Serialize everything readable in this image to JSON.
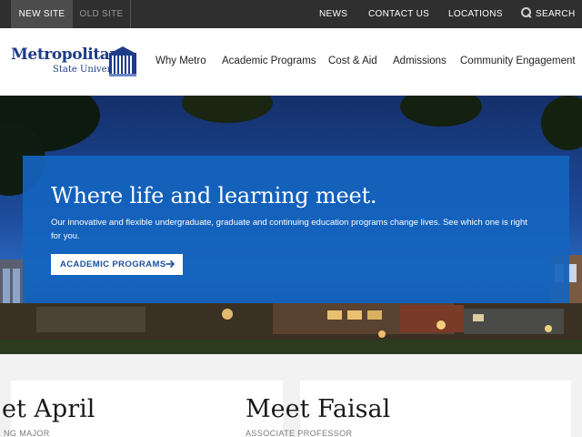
{
  "topbar": {
    "new_site": "NEW SITE",
    "old_site": "OLD SITE",
    "links": {
      "news": "NEWS",
      "contact": "CONTACT US",
      "locations": "LOCATIONS",
      "search": "SEARCH"
    },
    "search_icon": "search-icon"
  },
  "header": {
    "logo_line1": "Metropolitan",
    "logo_line2": "State University",
    "nav": [
      "Why Metro",
      "Academic Programs",
      "Cost & Aid",
      "Admissions",
      "Community Engagement"
    ]
  },
  "hero": {
    "title": "Where life and learning meet.",
    "description": "Our innovative and flexible undergraduate, graduate and continuing education programs change lives. See which one is right for you.",
    "button_label": "ACADEMIC PROGRAMS",
    "button_icon": "arrow-right-icon"
  },
  "profiles": [
    {
      "name": "et April",
      "role": "NG MAJOR"
    },
    {
      "name": "Meet Faisal",
      "role": "ASSOCIATE PROFESSOR"
    }
  ],
  "colors": {
    "topbar": "#2f2f2f",
    "brand_blue": "#1f3c88",
    "hero_panel": "#1464be",
    "accent": "#1a4fa0"
  }
}
